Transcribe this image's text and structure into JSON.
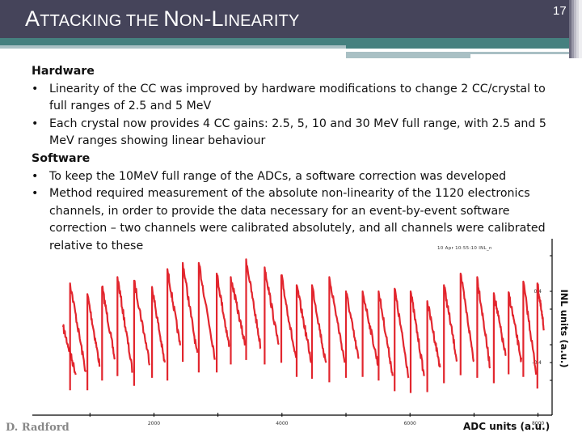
{
  "slide": {
    "title_parts": [
      {
        "text": "A",
        "small": false
      },
      {
        "text": "TTACKING THE ",
        "small": true
      },
      {
        "text": "N",
        "small": false
      },
      {
        "text": "ON",
        "small": true
      },
      {
        "text": "-L",
        "small": false
      },
      {
        "text": "INEARITY",
        "small": true
      }
    ],
    "title": "ATTACKING THE NON-LINEARITY",
    "page_number": "17",
    "footer_author": "D. Radford",
    "colors": {
      "header_dark": "#45445a",
      "header_teal": "#45807f",
      "header_light": "#a9c0c4",
      "trace": "#e0141c"
    }
  },
  "content": {
    "hardware_heading": "Hardware",
    "hardware_bullets": [
      "Linearity of the CC was improved by hardware modifications to change 2 CC/crystal to full ranges of 2.5 and 5 MeV",
      "Each crystal now provides 4 CC gains: 2.5, 5, 10 and 30 MeV full range, with 2.5 and 5 MeV ranges showing linear behaviour"
    ],
    "software_heading": "Software",
    "software_bullets": [
      "To keep the 10MeV full range of the ADCs, a software correction was developed",
      "Method required measurement of the absolute non-linearity of the 1120 electronics channels, in order to provide the data necessary for an event-by-event software correction – two channels were calibrated absolutely, and all channels were calibrated relative to these"
    ],
    "bullet_glyph": "•"
  },
  "chart_data": {
    "type": "line",
    "title": "",
    "stamp": "10 Apr 10:55:10 INL_n",
    "xlabel": "ADC units (a.u.)",
    "ylabel": "INL units (a.u.)",
    "xlim": [
      100,
      8220
    ],
    "ylim": [
      -1.0,
      1.0
    ],
    "x_tick_labels": [
      "2000",
      "4000",
      "6000",
      "8000"
    ],
    "x_ticks": [
      2000,
      4000,
      6000,
      8000
    ],
    "x_minor_ticks": [
      1000,
      3000,
      5000,
      7000
    ],
    "y_tick_labels": [
      "0.4",
      "-0.4"
    ],
    "y_ticks": [
      0.4,
      -0.4
    ],
    "y_minor_ticks": [
      0.8,
      0.2,
      -0.2,
      -0.6
    ],
    "grid": false,
    "legend": "none",
    "series": [
      {
        "name": "INL",
        "color": "#e0141c",
        "shape": "sawtooth",
        "cycles": [
          {
            "x0": 580,
            "peak": 0.0,
            "x1": 780,
            "trough": -0.53
          },
          {
            "x0": 690,
            "peak": 0.49,
            "x1": 940,
            "trough": -0.53
          },
          {
            "x0": 960,
            "peak": 0.37,
            "x1": 1150,
            "trough": -0.42
          },
          {
            "x0": 1190,
            "peak": 0.45,
            "x1": 1390,
            "trough": -0.37
          },
          {
            "x0": 1430,
            "peak": 0.56,
            "x1": 1660,
            "trough": -0.48
          },
          {
            "x0": 1690,
            "peak": 0.52,
            "x1": 1930,
            "trough": -0.39
          },
          {
            "x0": 1970,
            "peak": 0.45,
            "x1": 2170,
            "trough": -0.42
          },
          {
            "x0": 2210,
            "peak": 0.65,
            "x1": 2410,
            "trough": -0.21
          },
          {
            "x0": 2450,
            "peak": 0.72,
            "x1": 2680,
            "trough": -0.33
          },
          {
            "x0": 2700,
            "peak": 0.72,
            "x1": 2950,
            "trough": -0.33
          },
          {
            "x0": 2980,
            "peak": 0.6,
            "x1": 3180,
            "trough": -0.24
          },
          {
            "x0": 3200,
            "peak": 0.56,
            "x1": 3420,
            "trough": -0.19
          },
          {
            "x0": 3440,
            "peak": 0.76,
            "x1": 3670,
            "trough": -0.24
          },
          {
            "x0": 3730,
            "peak": 0.67,
            "x1": 3950,
            "trough": -0.22
          },
          {
            "x0": 3990,
            "peak": 0.58,
            "x1": 4220,
            "trough": -0.38
          },
          {
            "x0": 4230,
            "peak": 0.47,
            "x1": 4460,
            "trough": -0.4
          },
          {
            "x0": 4470,
            "peak": 0.47,
            "x1": 4690,
            "trough": -0.44
          },
          {
            "x0": 4740,
            "peak": 0.56,
            "x1": 4980,
            "trough": -0.39
          },
          {
            "x0": 5000,
            "peak": 0.4,
            "x1": 5200,
            "trough": -0.38
          },
          {
            "x0": 5260,
            "peak": 0.4,
            "x1": 5500,
            "trough": -0.42
          },
          {
            "x0": 5510,
            "peak": 0.4,
            "x1": 5730,
            "trough": -0.54
          },
          {
            "x0": 5760,
            "peak": 0.43,
            "x1": 5980,
            "trough": -0.56
          },
          {
            "x0": 6010,
            "peak": 0.4,
            "x1": 6220,
            "trough": -0.55
          },
          {
            "x0": 6270,
            "peak": 0.29,
            "x1": 6470,
            "trough": -0.45
          },
          {
            "x0": 6530,
            "peak": 0.47,
            "x1": 6730,
            "trough": -0.36
          },
          {
            "x0": 6790,
            "peak": 0.6,
            "x1": 7000,
            "trough": -0.39
          },
          {
            "x0": 7050,
            "peak": 0.56,
            "x1": 7250,
            "trough": -0.45
          },
          {
            "x0": 7310,
            "peak": 0.38,
            "x1": 7500,
            "trough": -0.35
          },
          {
            "x0": 7540,
            "peak": 0.39,
            "x1": 7740,
            "trough": -0.38
          },
          {
            "x0": 7770,
            "peak": 0.51,
            "x1": 7970,
            "trough": -0.51
          },
          {
            "x0": 7990,
            "peak": 0.49,
            "x1": 8090,
            "trough": -0.01
          }
        ]
      }
    ]
  }
}
